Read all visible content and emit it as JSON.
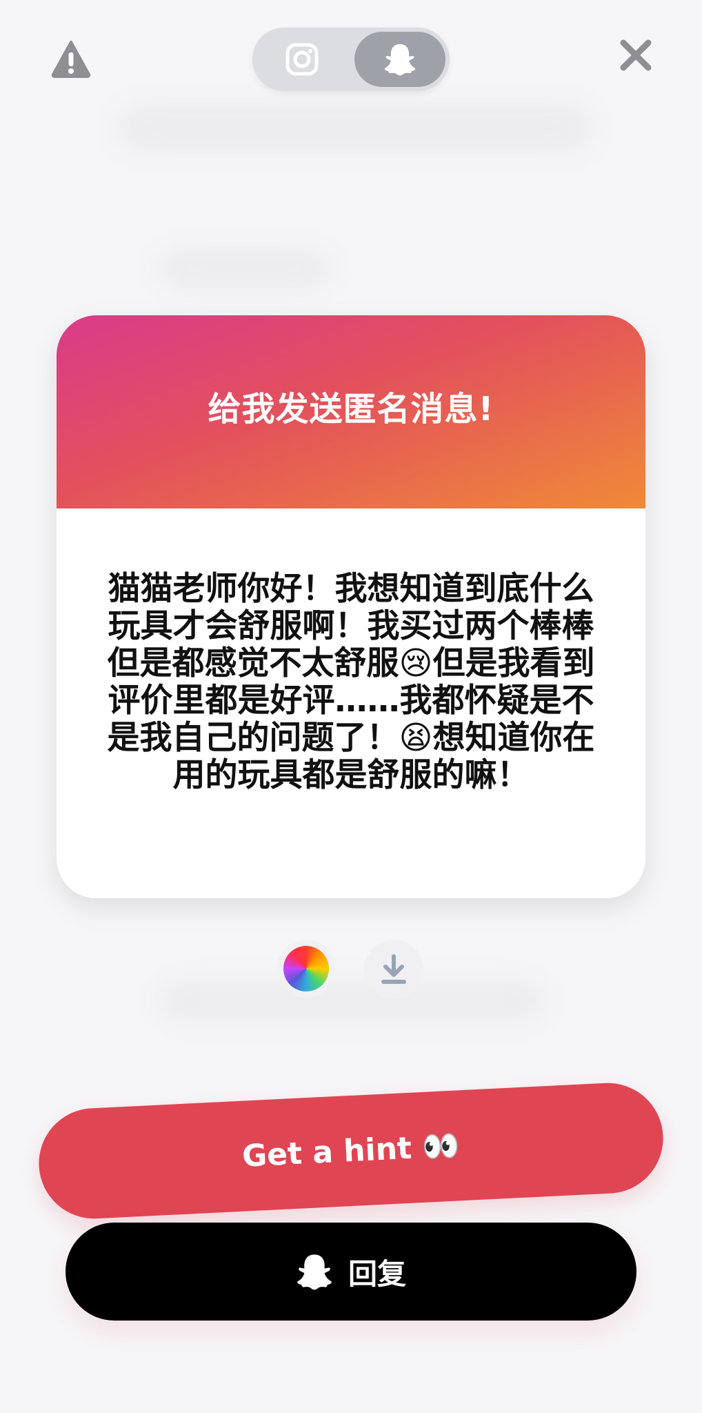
{
  "top_bar": {
    "report_icon": "warning-triangle-icon",
    "close_icon": "close-x-icon",
    "platform_toggle": {
      "options": [
        {
          "name": "instagram",
          "icon": "instagram-icon",
          "selected": false
        },
        {
          "name": "snapchat",
          "icon": "snapchat-ghost-icon",
          "selected": true
        }
      ]
    }
  },
  "card": {
    "title": "给我发送匿名消息!",
    "message": "猫猫老师你好！我想知道到底什么玩具才会舒服啊！我买过两个棒棒但是都感觉不太舒服😢但是我看到评价里都是好评……我都怀疑是不是我自己的问题了！😫想知道你在用的玩具都是舒服的嘛！"
  },
  "controls": {
    "color_picker_icon": "color-wheel-icon",
    "download_icon": "download-icon"
  },
  "buttons": {
    "hint_label": "Get a hint 👀",
    "reply_label": "回复",
    "reply_icon": "snapchat-ghost-icon"
  },
  "colors": {
    "gradient_start": "#d93b8a",
    "gradient_end": "#f08a38",
    "hint_button": "#e04553",
    "reply_button": "#000000"
  }
}
